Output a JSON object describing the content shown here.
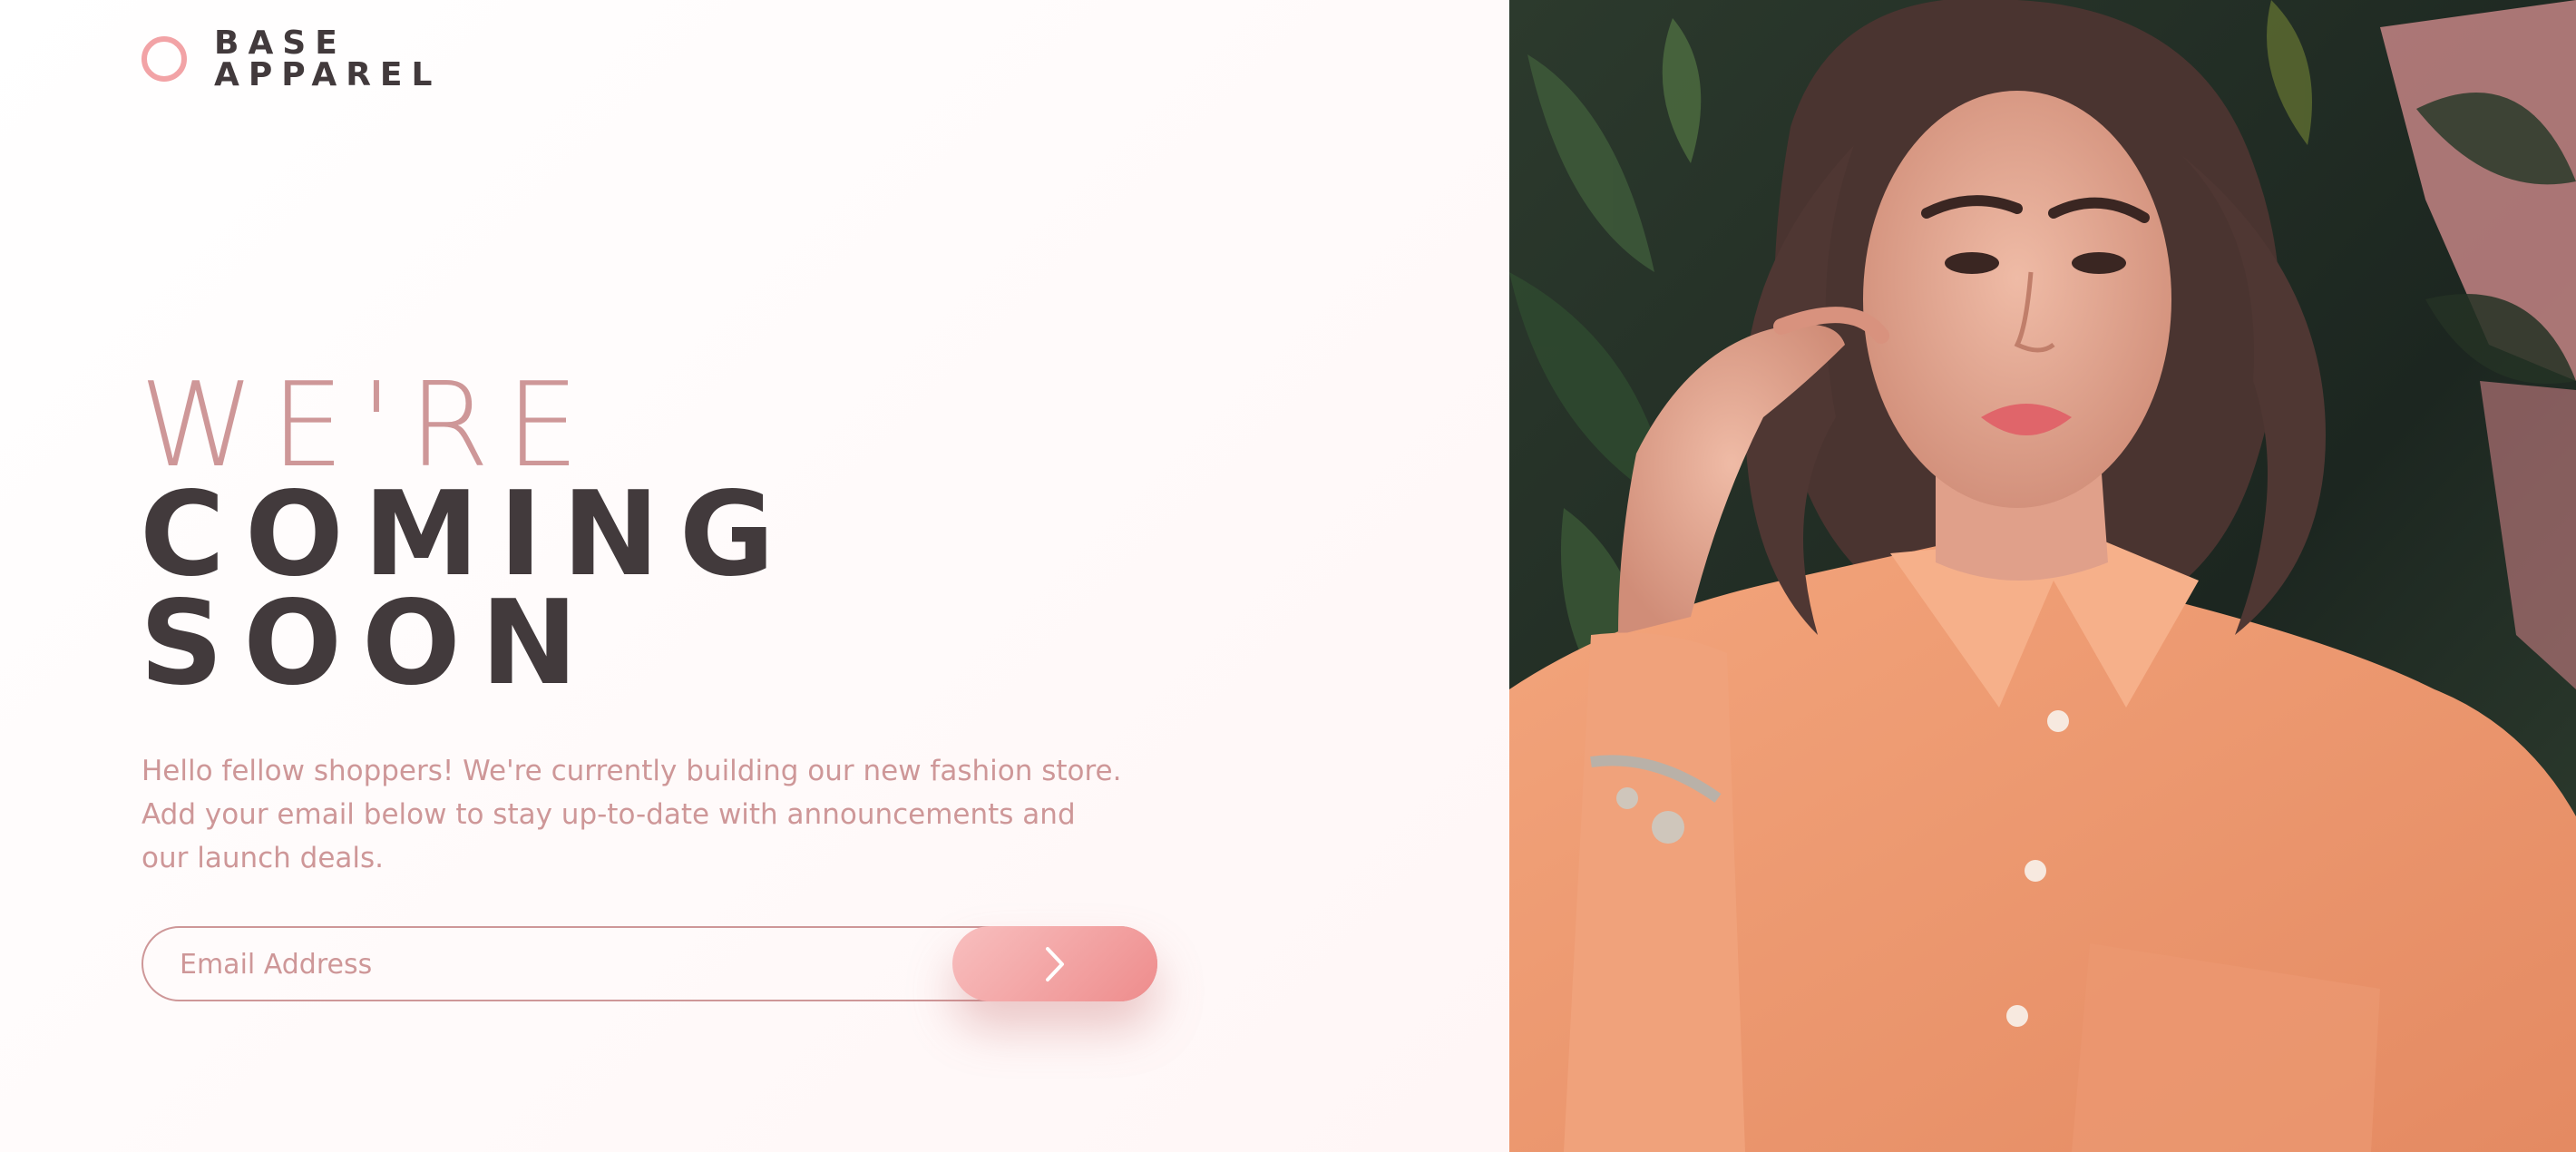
{
  "brand": {
    "line1": "BASE",
    "line2": "APPAREL",
    "accent_color": "#f2a3a6",
    "text_color": "#423a3c",
    "logo_icon": "ring-icon"
  },
  "headline": {
    "line1": "WE'RE",
    "line2": "COMING",
    "line3": "SOON"
  },
  "description": "Hello fellow shoppers! We're currently building our new fashion store. Add your email below to stay up-to-date with announcements and our launch deals.",
  "form": {
    "email_placeholder": "Email Address",
    "email_value": "",
    "submit_icon": "chevron-right-icon"
  },
  "colors": {
    "desaturated_red": "#ce9798",
    "dark_grayish_red": "#423a3c",
    "gradient_start": "#f8bfbf",
    "gradient_end": "#ee8c8c"
  },
  "hero_image": {
    "subject": "woman in peach shirt with bracelet against tropical foliage"
  }
}
